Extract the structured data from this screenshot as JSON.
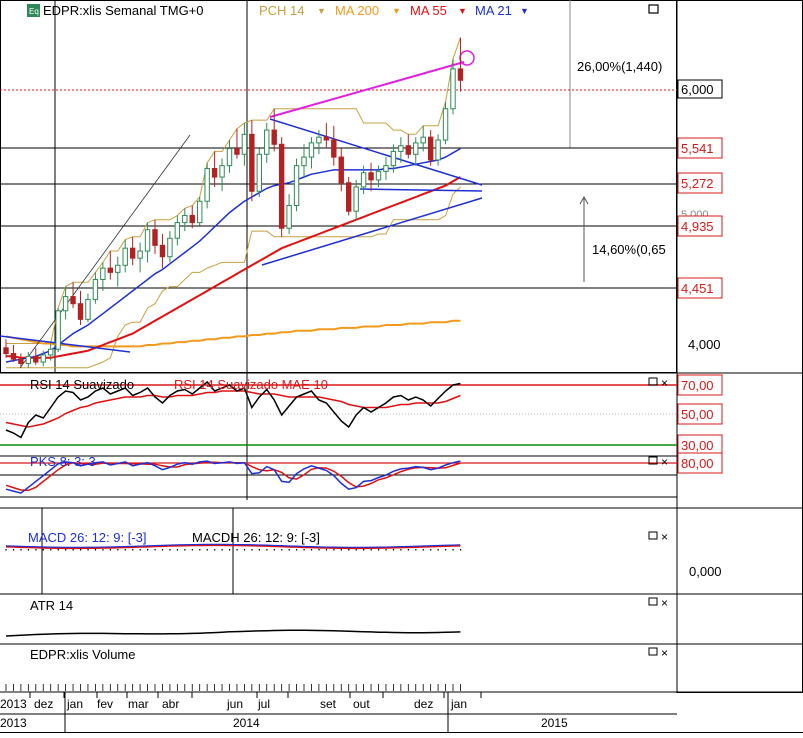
{
  "colors": {
    "up": "#2e8b57",
    "down": "#b22222",
    "ma21": "#1e2fd6",
    "ma55": "#e01010",
    "ma200": "#f39a1c",
    "pch": "#c8a040",
    "trend": "#e020e0",
    "grid": "#000000",
    "price_box_red": "#d81818"
  },
  "header": {
    "icon": "Eq",
    "instrument": "EDPR:xlis Semanal TMG+0",
    "indicators": [
      {
        "label": "PCH 14",
        "color": "#c8a040"
      },
      {
        "label": "MA 200",
        "color": "#f39a1c"
      },
      {
        "label": "MA 55",
        "color": "#e01010"
      },
      {
        "label": "MA 21",
        "color": "#1e2fd6"
      }
    ]
  },
  "annotations": {
    "move_up": "26,00%(1,440)",
    "move_range": "14,60%(0,65"
  },
  "price_axis": {
    "current": "6,000",
    "levels": [
      "5,541",
      "5,272",
      "4,935",
      "4,451"
    ],
    "ticks": [
      "4,000"
    ],
    "partial": "5,000"
  },
  "rsi_panel": {
    "title": "RSI 14 Suavizado",
    "title2": "RSI 14 Suavizado MAE 10",
    "levels": [
      "70,00",
      "50,00",
      "30,00"
    ]
  },
  "pks_panel": {
    "title": "PKS 8: 3: 3",
    "level": "80,00"
  },
  "macd_panel": {
    "title": "MACD 26: 12: 9: [-3]",
    "title2": "MACDH 26: 12: 9: [-3]",
    "tick": "0,000"
  },
  "atr_panel": {
    "title": "ATR 14"
  },
  "volume_panel": {
    "title": "EDPR:xlis Volume"
  },
  "time_axis": {
    "months": [
      "2013",
      "dez",
      "jan",
      "fev",
      "mar",
      "abr",
      "jun",
      "jul",
      "set",
      "out",
      "dez",
      "jan"
    ],
    "years": [
      "2013",
      "2014",
      "2015"
    ]
  },
  "chart_data": {
    "type": "candlestick",
    "title": "EDPR:xlis Semanal TMG+0",
    "ylim": [
      3.85,
      6.45
    ],
    "x_labels": [
      "dez",
      "jan",
      "fev",
      "mar",
      "abr",
      "jun",
      "jul",
      "set",
      "out",
      "dez",
      "jan"
    ],
    "candles": [
      [
        4.02,
        4.08,
        3.95,
        3.98
      ],
      [
        3.98,
        4.04,
        3.92,
        3.94
      ],
      [
        3.94,
        3.98,
        3.88,
        3.91
      ],
      [
        3.91,
        3.99,
        3.88,
        3.96
      ],
      [
        3.96,
        4.02,
        3.9,
        3.92
      ],
      [
        3.92,
        4.0,
        3.89,
        3.97
      ],
      [
        3.97,
        4.05,
        3.93,
        4.01
      ],
      [
        4.01,
        4.3,
        3.99,
        4.28
      ],
      [
        4.28,
        4.45,
        4.22,
        4.38
      ],
      [
        4.38,
        4.48,
        4.3,
        4.33
      ],
      [
        4.33,
        4.42,
        4.18,
        4.22
      ],
      [
        4.22,
        4.4,
        4.2,
        4.36
      ],
      [
        4.36,
        4.55,
        4.33,
        4.5
      ],
      [
        4.5,
        4.62,
        4.42,
        4.58
      ],
      [
        4.58,
        4.7,
        4.5,
        4.55
      ],
      [
        4.55,
        4.66,
        4.45,
        4.6
      ],
      [
        4.6,
        4.78,
        4.55,
        4.72
      ],
      [
        4.72,
        4.8,
        4.6,
        4.65
      ],
      [
        4.65,
        4.76,
        4.55,
        4.7
      ],
      [
        4.7,
        4.9,
        4.62,
        4.85
      ],
      [
        4.85,
        4.92,
        4.68,
        4.74
      ],
      [
        4.74,
        4.82,
        4.58,
        4.66
      ],
      [
        4.66,
        4.84,
        4.62,
        4.79
      ],
      [
        4.79,
        4.95,
        4.74,
        4.9
      ],
      [
        4.9,
        5.0,
        4.84,
        4.95
      ],
      [
        4.95,
        5.02,
        4.86,
        4.9
      ],
      [
        4.9,
        5.08,
        4.88,
        5.05
      ],
      [
        5.05,
        5.32,
        5.0,
        5.28
      ],
      [
        5.28,
        5.4,
        5.15,
        5.22
      ],
      [
        5.22,
        5.35,
        5.12,
        5.3
      ],
      [
        5.3,
        5.48,
        5.25,
        5.42
      ],
      [
        5.42,
        5.56,
        5.35,
        5.38
      ],
      [
        5.38,
        5.6,
        5.3,
        5.52
      ],
      [
        5.52,
        5.62,
        5.05,
        5.12
      ],
      [
        5.12,
        5.42,
        5.08,
        5.38
      ],
      [
        5.38,
        5.6,
        5.32,
        5.55
      ],
      [
        5.55,
        5.7,
        5.4,
        5.45
      ],
      [
        5.45,
        5.5,
        4.8,
        4.86
      ],
      [
        4.86,
        5.1,
        4.82,
        5.02
      ],
      [
        5.02,
        5.35,
        4.98,
        5.3
      ],
      [
        5.3,
        5.45,
        5.22,
        5.36
      ],
      [
        5.36,
        5.5,
        5.28,
        5.46
      ],
      [
        5.46,
        5.55,
        5.38,
        5.5
      ],
      [
        5.5,
        5.6,
        5.42,
        5.48
      ],
      [
        5.48,
        5.58,
        5.3,
        5.36
      ],
      [
        5.36,
        5.42,
        5.12,
        5.18
      ],
      [
        5.18,
        5.22,
        4.95,
        4.98
      ],
      [
        4.98,
        5.2,
        4.92,
        5.15
      ],
      [
        5.15,
        5.3,
        5.1,
        5.25
      ],
      [
        5.25,
        5.32,
        5.12,
        5.2
      ],
      [
        5.2,
        5.3,
        5.15,
        5.26
      ],
      [
        5.26,
        5.36,
        5.2,
        5.3
      ],
      [
        5.3,
        5.45,
        5.25,
        5.4
      ],
      [
        5.4,
        5.5,
        5.32,
        5.44
      ],
      [
        5.44,
        5.52,
        5.35,
        5.38
      ],
      [
        5.38,
        5.5,
        5.3,
        5.46
      ],
      [
        5.46,
        5.58,
        5.4,
        5.5
      ],
      [
        5.5,
        5.55,
        5.3,
        5.34
      ],
      [
        5.34,
        5.52,
        5.3,
        5.48
      ],
      [
        5.48,
        5.75,
        5.45,
        5.7
      ],
      [
        5.7,
        6.05,
        5.66,
        5.98
      ],
      [
        5.98,
        6.2,
        5.82,
        5.9
      ]
    ],
    "series_ma21": [
      3.92,
      3.93,
      3.94,
      3.95,
      3.96,
      3.98,
      4.0,
      4.04,
      4.08,
      4.12,
      4.15,
      4.18,
      4.22,
      4.26,
      4.3,
      4.34,
      4.38,
      4.42,
      4.46,
      4.5,
      4.54,
      4.57,
      4.61,
      4.65,
      4.69,
      4.73,
      4.77,
      4.82,
      4.87,
      4.92,
      4.97,
      5.01,
      5.05,
      5.08,
      5.11,
      5.14,
      5.16,
      5.17,
      5.18,
      5.2,
      5.22,
      5.24,
      5.25,
      5.26,
      5.27,
      5.27,
      5.27,
      5.27,
      5.27,
      5.27,
      5.27,
      5.28,
      5.28,
      5.29,
      5.3,
      5.31,
      5.32,
      5.33,
      5.34,
      5.36,
      5.39,
      5.42
    ],
    "series_ma55": [
      3.96,
      3.96,
      3.95,
      3.95,
      3.95,
      3.95,
      3.95,
      3.96,
      3.97,
      3.98,
      3.99,
      4.0,
      4.02,
      4.04,
      4.06,
      4.08,
      4.1,
      4.12,
      4.15,
      4.18,
      4.21,
      4.24,
      4.27,
      4.3,
      4.33,
      4.36,
      4.39,
      4.42,
      4.45,
      4.48,
      4.51,
      4.54,
      4.57,
      4.6,
      4.63,
      4.66,
      4.69,
      4.72,
      4.74,
      4.76,
      4.78,
      4.8,
      4.82,
      4.84,
      4.86,
      4.88,
      4.9,
      4.92,
      4.94,
      4.96,
      4.98,
      5.0,
      5.02,
      5.04,
      5.06,
      5.08,
      5.1,
      5.12,
      5.14,
      5.16,
      5.19,
      5.22
    ],
    "series_ma200": [
      4.1,
      4.09,
      4.08,
      4.07,
      4.06,
      4.05,
      4.05,
      4.04,
      4.04,
      4.03,
      4.03,
      4.03,
      4.03,
      4.03,
      4.03,
      4.03,
      4.03,
      4.03,
      4.03,
      4.04,
      4.04,
      4.05,
      4.05,
      4.06,
      4.06,
      4.07,
      4.07,
      4.08,
      4.08,
      4.09,
      4.09,
      4.1,
      4.1,
      4.11,
      4.11,
      4.12,
      4.12,
      4.13,
      4.13,
      4.14,
      4.14,
      4.14,
      4.15,
      4.15,
      4.15,
      4.16,
      4.16,
      4.16,
      4.17,
      4.17,
      4.17,
      4.18,
      4.18,
      4.18,
      4.19,
      4.19,
      4.19,
      4.2,
      4.2,
      4.2,
      4.21,
      4.21
    ],
    "series_pch_high": [
      4.05,
      4.05,
      4.05,
      4.05,
      4.05,
      4.05,
      4.05,
      4.3,
      4.45,
      4.48,
      4.48,
      4.48,
      4.55,
      4.62,
      4.7,
      4.7,
      4.78,
      4.8,
      4.8,
      4.9,
      4.92,
      4.92,
      4.92,
      4.95,
      5.0,
      5.02,
      5.08,
      5.32,
      5.4,
      5.4,
      5.48,
      5.56,
      5.6,
      5.62,
      5.62,
      5.62,
      5.7,
      5.7,
      5.7,
      5.7,
      5.7,
      5.7,
      5.7,
      5.7,
      5.7,
      5.7,
      5.7,
      5.7,
      5.6,
      5.6,
      5.6,
      5.6,
      5.55,
      5.55,
      5.52,
      5.52,
      5.58,
      5.58,
      5.58,
      5.75,
      6.05,
      6.2
    ],
    "series_pch_low": [
      3.88,
      3.88,
      3.88,
      3.88,
      3.88,
      3.88,
      3.88,
      3.88,
      3.88,
      3.88,
      3.88,
      3.88,
      3.9,
      3.92,
      3.95,
      4.1,
      4.18,
      4.2,
      4.2,
      4.3,
      4.33,
      4.42,
      4.45,
      4.45,
      4.5,
      4.55,
      4.55,
      4.58,
      4.6,
      4.62,
      4.62,
      4.62,
      4.62,
      4.84,
      4.84,
      4.84,
      4.8,
      4.8,
      4.8,
      4.8,
      4.8,
      4.8,
      4.8,
      4.8,
      4.8,
      4.8,
      4.8,
      4.8,
      4.8,
      4.8,
      4.82,
      4.82,
      4.92,
      4.92,
      4.92,
      4.92,
      4.92,
      4.92,
      4.92,
      4.95,
      5.1,
      5.15
    ],
    "rsi": [
      40,
      38,
      35,
      45,
      50,
      48,
      55,
      62,
      66,
      65,
      60,
      62,
      66,
      68,
      64,
      66,
      68,
      63,
      65,
      68,
      62,
      58,
      63,
      66,
      67,
      64,
      68,
      72,
      66,
      68,
      70,
      66,
      68,
      55,
      62,
      67,
      60,
      50,
      56,
      62,
      64,
      66,
      60,
      58,
      52,
      46,
      42,
      50,
      55,
      52,
      55,
      58,
      62,
      63,
      60,
      62,
      60,
      56,
      61,
      66,
      70,
      71
    ],
    "rsi_signal": [
      45,
      44,
      43,
      42,
      43,
      44,
      46,
      48,
      51,
      53,
      55,
      56,
      58,
      59,
      60,
      61,
      62,
      62,
      62,
      63,
      63,
      62,
      62,
      63,
      63,
      63,
      64,
      65,
      65,
      66,
      66,
      66,
      66,
      65,
      64,
      64,
      64,
      63,
      62,
      62,
      62,
      62,
      62,
      61,
      60,
      59,
      57,
      56,
      55,
      55,
      55,
      55,
      56,
      57,
      57,
      58,
      58,
      58,
      58,
      59,
      61,
      63
    ],
    "pks_k": [
      20,
      15,
      10,
      25,
      40,
      55,
      70,
      85,
      90,
      88,
      80,
      84,
      88,
      90,
      82,
      86,
      90,
      80,
      84,
      88,
      80,
      70,
      76,
      84,
      88,
      84,
      90,
      92,
      86,
      88,
      90,
      86,
      88,
      60,
      62,
      78,
      70,
      40,
      38,
      60,
      72,
      80,
      74,
      68,
      55,
      35,
      20,
      24,
      40,
      42,
      50,
      56,
      66,
      72,
      74,
      78,
      76,
      70,
      74,
      82,
      88,
      92
    ],
    "pks_d": [
      30,
      24,
      18,
      17,
      25,
      40,
      55,
      70,
      82,
      88,
      86,
      84,
      84,
      87,
      87,
      86,
      86,
      85,
      85,
      84,
      84,
      80,
      77,
      77,
      83,
      85,
      87,
      89,
      89,
      88,
      88,
      88,
      88,
      78,
      70,
      67,
      70,
      63,
      49,
      46,
      57,
      71,
      75,
      74,
      66,
      53,
      37,
      26,
      28,
      35,
      44,
      49,
      57,
      65,
      71,
      75,
      76,
      75,
      74,
      75,
      81,
      87
    ]
  }
}
